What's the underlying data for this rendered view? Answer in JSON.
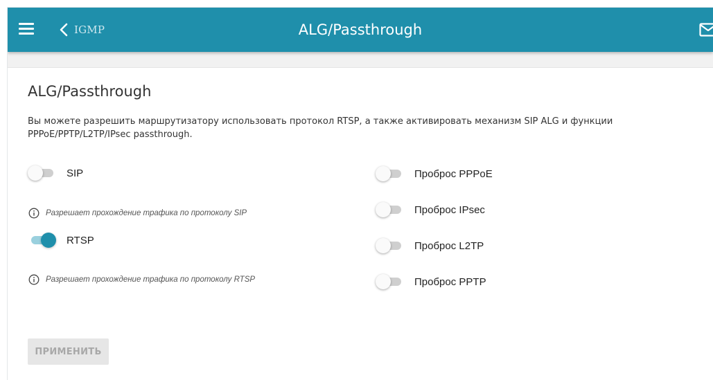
{
  "header": {
    "back_label": "IGMP",
    "title": "ALG/Passthrough",
    "color": "#1f8fab"
  },
  "main": {
    "title": "ALG/Passthrough",
    "description": "Вы можете разрешить маршрутизатору использовать протокол RTSP, а также активировать механизм SIP ALG и функции PPPoE/PPTP/L2TP/IPsec passthrough."
  },
  "left_toggles": [
    {
      "label": "SIP",
      "enabled": false,
      "hint": "Разрешает прохождение трафика по протоколу SIP"
    },
    {
      "label": "RTSP",
      "enabled": true,
      "hint": "Разрешает прохождение трафика по протоколу RTSP"
    }
  ],
  "right_toggles": [
    {
      "label": "Проброс PPPoE",
      "enabled": false
    },
    {
      "label": "Проброс IPsec",
      "enabled": false
    },
    {
      "label": "Проброс L2TP",
      "enabled": false
    },
    {
      "label": "Проброс PPTP",
      "enabled": false
    }
  ],
  "apply_button": {
    "label": "ПРИМЕНИТЬ",
    "disabled": true
  },
  "icons": {
    "menu": "hamburger-menu-icon",
    "back": "chevron-left-icon",
    "mail": "mail-icon",
    "info": "info-icon"
  }
}
